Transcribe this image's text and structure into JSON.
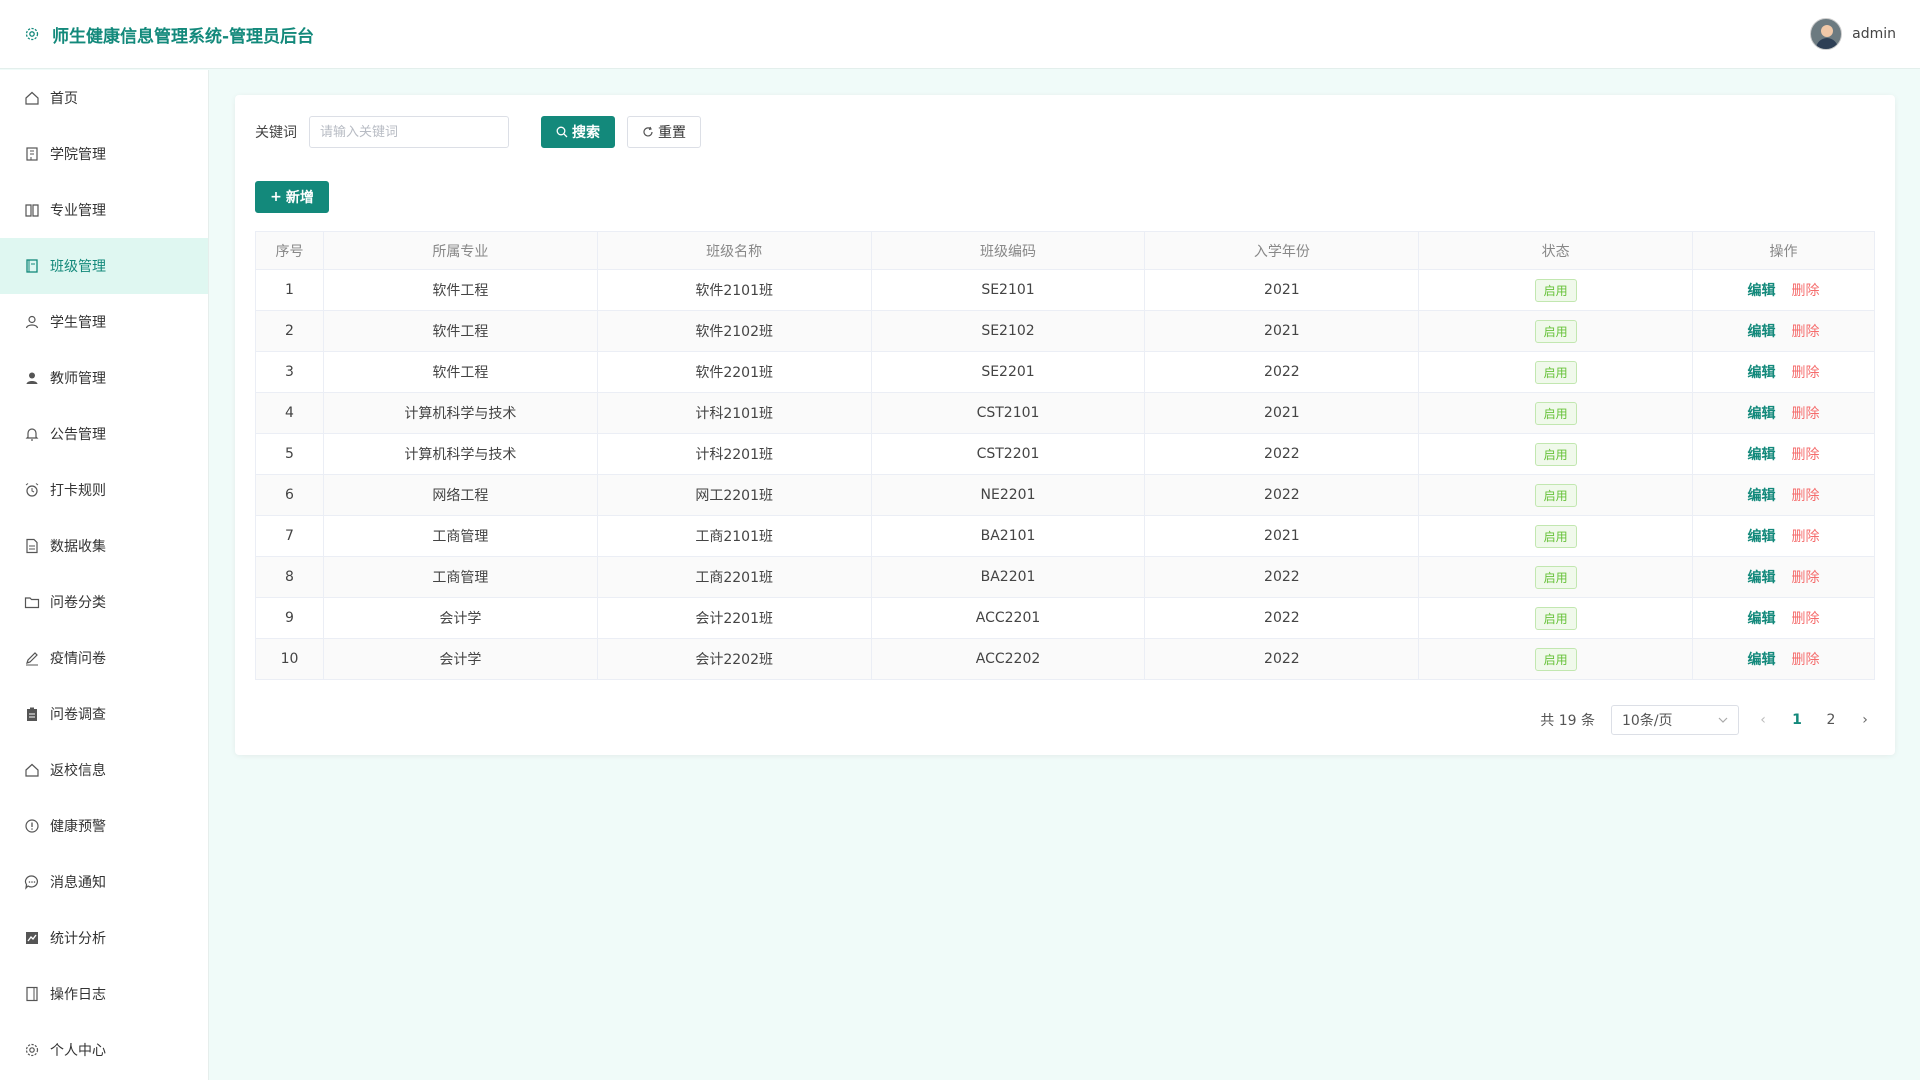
{
  "header": {
    "title": "师生健康信息管理系统-管理员后台",
    "username": "admin"
  },
  "colors": {
    "accent": "#13897b",
    "active_bg": "#dff7f1",
    "delete": "#f56c6c",
    "status_green": "#67c23a"
  },
  "sidebar": {
    "items": [
      {
        "label": "首页",
        "icon": "home-icon"
      },
      {
        "label": "学院管理",
        "icon": "building-icon"
      },
      {
        "label": "专业管理",
        "icon": "book-icon"
      },
      {
        "label": "班级管理",
        "icon": "notebook-icon",
        "active": true
      },
      {
        "label": "学生管理",
        "icon": "user-icon"
      },
      {
        "label": "教师管理",
        "icon": "user-filled-icon"
      },
      {
        "label": "公告管理",
        "icon": "bell-icon"
      },
      {
        "label": "打卡规则",
        "icon": "alarm-clock-icon"
      },
      {
        "label": "数据收集",
        "icon": "document-icon"
      },
      {
        "label": "问卷分类",
        "icon": "folder-icon"
      },
      {
        "label": "疫情问卷",
        "icon": "edit-pen-icon"
      },
      {
        "label": "问卷调查",
        "icon": "clipboard-icon"
      },
      {
        "label": "返校信息",
        "icon": "home-return-icon"
      },
      {
        "label": "健康预警",
        "icon": "warning-icon"
      },
      {
        "label": "消息通知",
        "icon": "chat-icon"
      },
      {
        "label": "统计分析",
        "icon": "chart-icon"
      },
      {
        "label": "操作日志",
        "icon": "log-book-icon"
      },
      {
        "label": "个人中心",
        "icon": "settings-icon"
      }
    ]
  },
  "search": {
    "label": "关键词",
    "placeholder": "请输入关键词",
    "search_label": "搜索",
    "reset_label": "重置",
    "add_label": "新增"
  },
  "table": {
    "columns": [
      "序号",
      "所属专业",
      "班级名称",
      "班级编码",
      "入学年份",
      "状态",
      "操作"
    ],
    "edit_label": "编辑",
    "delete_label": "删除",
    "rows": [
      {
        "no": "1",
        "major": "软件工程",
        "class_name": "软件2101班",
        "code": "SE2101",
        "year": "2021",
        "status": "启用"
      },
      {
        "no": "2",
        "major": "软件工程",
        "class_name": "软件2102班",
        "code": "SE2102",
        "year": "2021",
        "status": "启用"
      },
      {
        "no": "3",
        "major": "软件工程",
        "class_name": "软件2201班",
        "code": "SE2201",
        "year": "2022",
        "status": "启用"
      },
      {
        "no": "4",
        "major": "计算机科学与技术",
        "class_name": "计科2101班",
        "code": "CST2101",
        "year": "2021",
        "status": "启用"
      },
      {
        "no": "5",
        "major": "计算机科学与技术",
        "class_name": "计科2201班",
        "code": "CST2201",
        "year": "2022",
        "status": "启用"
      },
      {
        "no": "6",
        "major": "网络工程",
        "class_name": "网工2201班",
        "code": "NE2201",
        "year": "2022",
        "status": "启用"
      },
      {
        "no": "7",
        "major": "工商管理",
        "class_name": "工商2101班",
        "code": "BA2101",
        "year": "2021",
        "status": "启用"
      },
      {
        "no": "8",
        "major": "工商管理",
        "class_name": "工商2201班",
        "code": "BA2201",
        "year": "2022",
        "status": "启用"
      },
      {
        "no": "9",
        "major": "会计学",
        "class_name": "会计2201班",
        "code": "ACC2201",
        "year": "2022",
        "status": "启用"
      },
      {
        "no": "10",
        "major": "会计学",
        "class_name": "会计2202班",
        "code": "ACC2202",
        "year": "2022",
        "status": "启用"
      }
    ]
  },
  "pagination": {
    "total_text": "共 19 条",
    "page_size": "10条/页",
    "pages": [
      "1",
      "2"
    ],
    "current": "1"
  }
}
